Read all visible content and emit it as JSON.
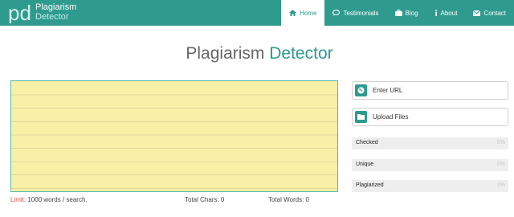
{
  "brand": {
    "line1": "Plagiarism",
    "line2": "Detector"
  },
  "nav": [
    {
      "label": "Home",
      "icon": "home-icon",
      "active": true
    },
    {
      "label": "Testimonials",
      "icon": "speech-bubble-icon"
    },
    {
      "label": "Blog",
      "icon": "briefcase-icon"
    },
    {
      "label": "About",
      "icon": "info-icon"
    },
    {
      "label": "Contact",
      "icon": "envelope-icon"
    }
  ],
  "title": {
    "part1": "Plagiarism",
    "part2": "Detector"
  },
  "editor": {
    "value": "",
    "limit_label": "Limit:",
    "limit_text": "1000 words / search.",
    "total_chars": "Total Chars: 0",
    "total_words": "Total Words: 0"
  },
  "actions": {
    "enter_url": "Enter URL",
    "upload_files": "Upload Files"
  },
  "stats": [
    {
      "label": "Checked",
      "value": "0%"
    },
    {
      "label": "Unique",
      "value": "0%"
    },
    {
      "label": "Plagiarized",
      "value": "0%"
    }
  ],
  "colors": {
    "accent": "#2f9a8e",
    "paper": "#f8f0a6",
    "limit": "#d9534f"
  }
}
